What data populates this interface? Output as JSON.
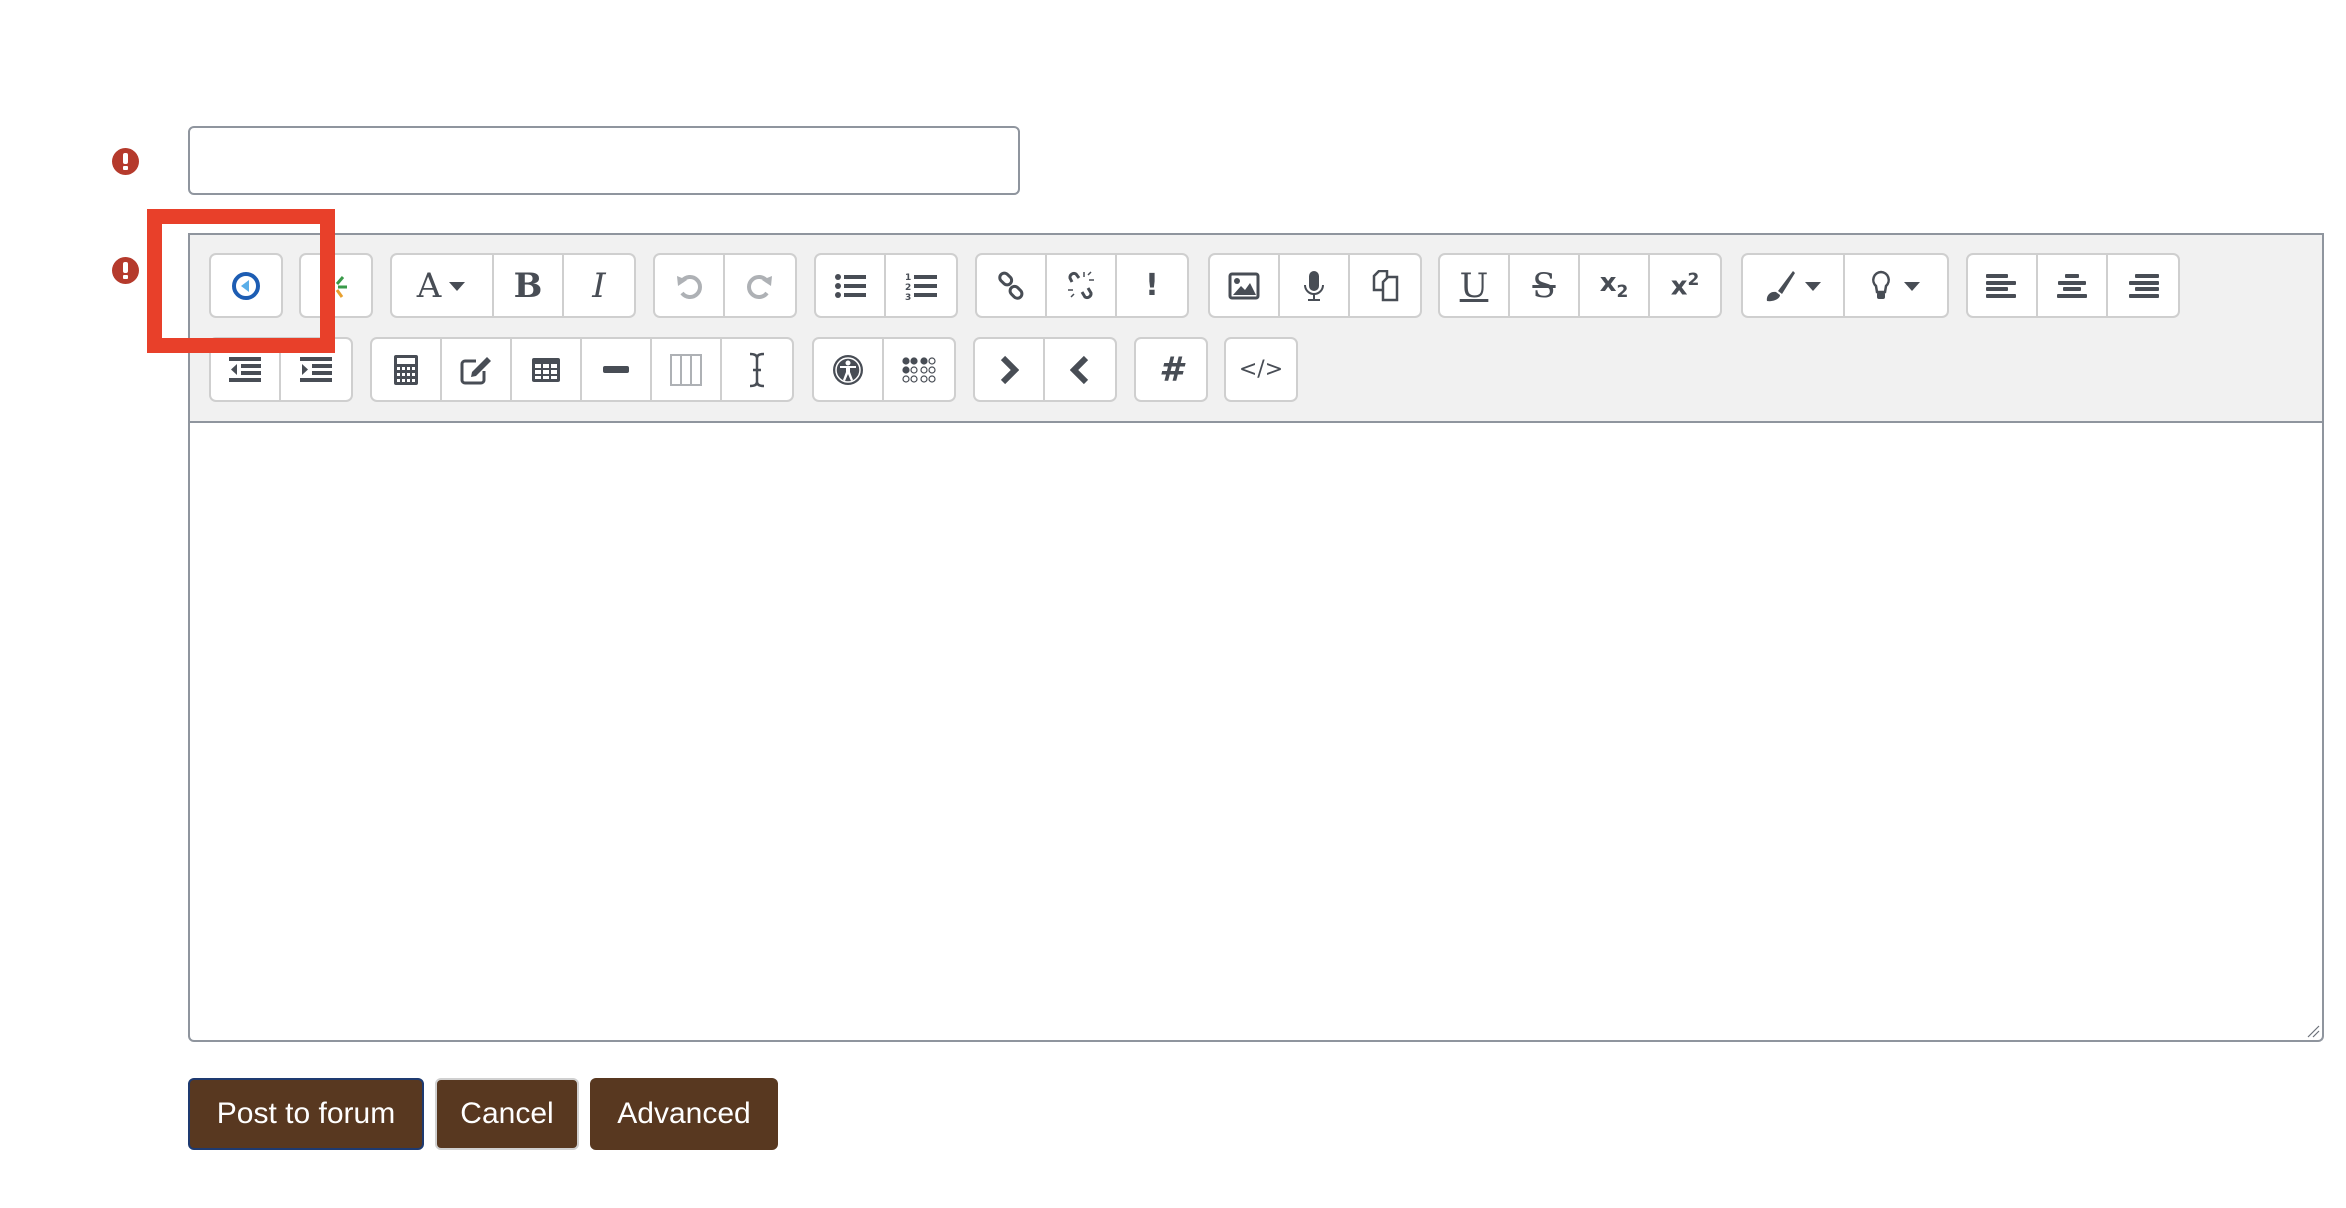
{
  "form": {
    "subject": {
      "value": "",
      "placeholder": "",
      "required": true
    },
    "message": {
      "value": "",
      "required": true
    }
  },
  "toolbar": {
    "row1": [
      {
        "group": [
          {
            "name": "collapse-toggle",
            "icon": "collapse-icon"
          }
        ]
      },
      {
        "group": [
          {
            "name": "accessibility-spinner",
            "icon": "sparkle-icon"
          }
        ]
      },
      {
        "group": [
          {
            "name": "font-style",
            "icon": "font-icon",
            "label": "A"
          },
          {
            "name": "bold",
            "icon": "bold-icon",
            "label": "B"
          },
          {
            "name": "italic",
            "icon": "italic-icon",
            "label": "I"
          }
        ]
      },
      {
        "group": [
          {
            "name": "undo",
            "icon": "undo-icon",
            "disabled": true
          },
          {
            "name": "redo",
            "icon": "redo-icon",
            "disabled": true
          }
        ]
      },
      {
        "group": [
          {
            "name": "unordered-list",
            "icon": "bullet-list-icon"
          },
          {
            "name": "ordered-list",
            "icon": "numbered-list-icon"
          }
        ]
      },
      {
        "group": [
          {
            "name": "link",
            "icon": "link-icon"
          },
          {
            "name": "unlink",
            "icon": "unlink-icon"
          },
          {
            "name": "auto-link",
            "icon": "exclamation-icon",
            "label": "!"
          }
        ]
      },
      {
        "group": [
          {
            "name": "image",
            "icon": "image-icon"
          },
          {
            "name": "media",
            "icon": "microphone-icon"
          },
          {
            "name": "manage-files",
            "icon": "files-icon"
          }
        ]
      },
      {
        "group": [
          {
            "name": "underline",
            "icon": "underline-icon",
            "label": "U"
          },
          {
            "name": "strikethrough",
            "icon": "strikethrough-icon",
            "label": "S"
          },
          {
            "name": "subscript",
            "icon": "subscript-icon",
            "label": "x",
            "sub": "2"
          },
          {
            "name": "superscript",
            "icon": "superscript-icon",
            "label": "x",
            "sup": "2"
          }
        ]
      },
      {
        "group": [
          {
            "name": "font-color",
            "icon": "paintbrush-icon"
          },
          {
            "name": "background-color",
            "icon": "lightbulb-icon"
          }
        ]
      },
      {
        "group": [
          {
            "name": "align-left",
            "icon": "align-left-icon"
          },
          {
            "name": "align-center",
            "icon": "align-center-icon"
          },
          {
            "name": "align-right",
            "icon": "align-right-icon"
          }
        ]
      }
    ],
    "row2": [
      {
        "group": [
          {
            "name": "outdent",
            "icon": "outdent-icon"
          },
          {
            "name": "indent",
            "icon": "indent-icon"
          }
        ]
      },
      {
        "group": [
          {
            "name": "equation",
            "icon": "calculator-icon"
          },
          {
            "name": "special-chars",
            "icon": "edit-icon"
          },
          {
            "name": "table",
            "icon": "table-icon"
          },
          {
            "name": "horizontal-rule",
            "icon": "minus-icon"
          },
          {
            "name": "columns",
            "icon": "columns-icon",
            "disabled": true
          },
          {
            "name": "clear-formatting",
            "icon": "text-cursor-icon"
          }
        ]
      },
      {
        "group": [
          {
            "name": "accessibility-checker",
            "icon": "accessibility-icon"
          },
          {
            "name": "screenreader-helper",
            "icon": "braille-icon"
          }
        ]
      },
      {
        "group": [
          {
            "name": "ltr",
            "icon": "chevron-right-icon"
          },
          {
            "name": "rtl",
            "icon": "chevron-left-icon"
          }
        ]
      },
      {
        "group": [
          {
            "name": "hashtag",
            "icon": "hash-icon",
            "label": "#"
          }
        ]
      },
      {
        "group": [
          {
            "name": "html",
            "icon": "code-icon",
            "label": "</>"
          }
        ]
      }
    ]
  },
  "actions": {
    "post_label": "Post to forum",
    "cancel_label": "Cancel",
    "advanced_label": "Advanced"
  },
  "colors": {
    "button_bg": "#583820",
    "required_icon": "#b53a2c",
    "highlight": "#e8402a",
    "toolbar_bg": "#f1f1f1",
    "icon": "#484d55"
  }
}
